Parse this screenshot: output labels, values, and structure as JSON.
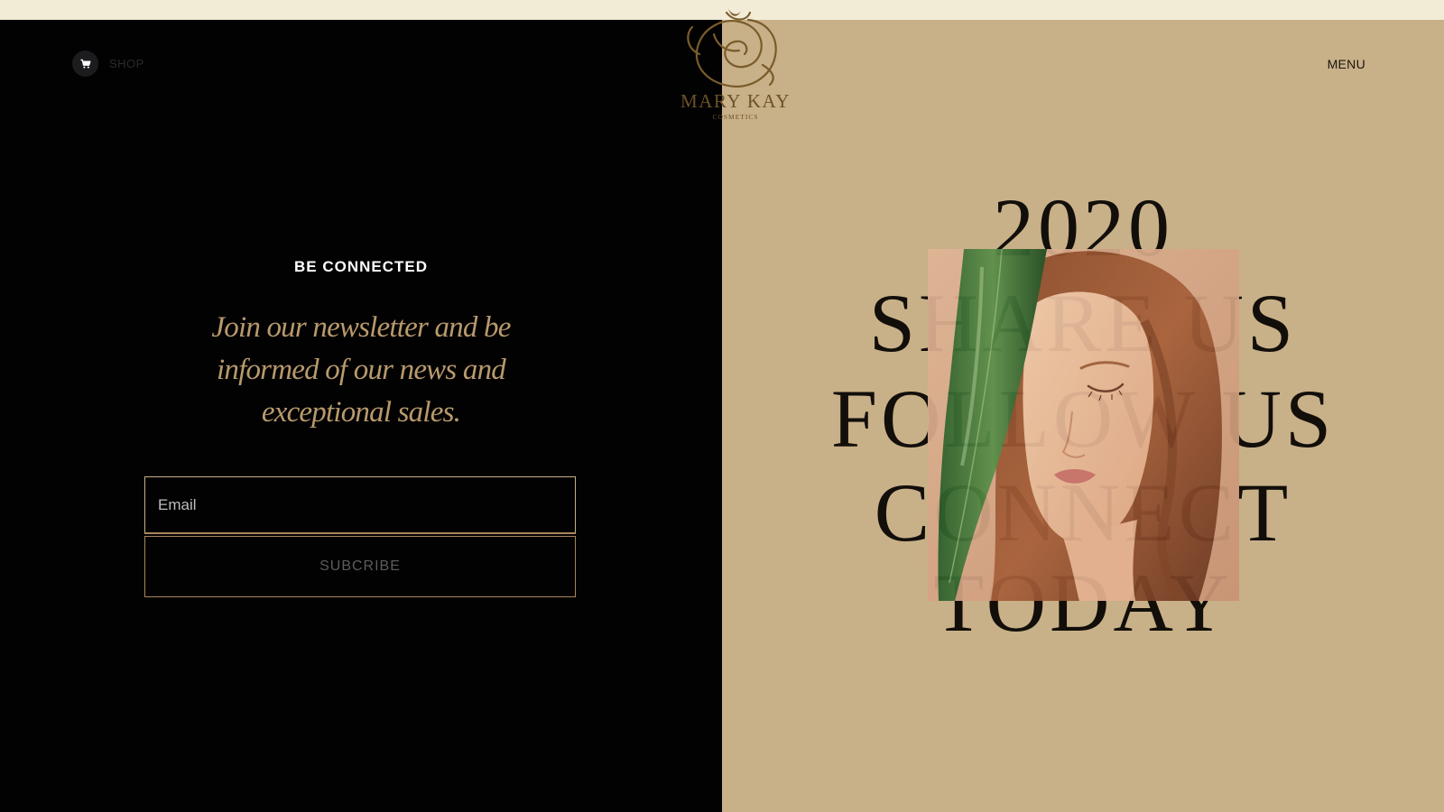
{
  "header": {
    "shop_label": "SHOP",
    "menu_label": "MENU",
    "cart_icon": "cart-icon"
  },
  "logo": {
    "name": "MARY KAY",
    "subtitle": "COSMETICS",
    "icon": "rose-icon"
  },
  "newsletter": {
    "heading": "BE CONNECTED",
    "body": "Join our newsletter and be informed of our news and exceptional sales.",
    "email_placeholder": "Email",
    "email_value": "",
    "subscribe_label": "SUBCRIBE"
  },
  "hero": {
    "lines": [
      "2020",
      "SHARE US",
      "FOLLOW US",
      "CONNECT",
      "TODAY"
    ],
    "photo_icon": "portrait-photo"
  },
  "colors": {
    "left_background": "#030203",
    "right_background": "#c8b088",
    "top_strip": "#f2ecd6",
    "accent_gold": "#b89a6c",
    "logo_gold": "#6b5226",
    "hero_text": "#120e0a"
  }
}
